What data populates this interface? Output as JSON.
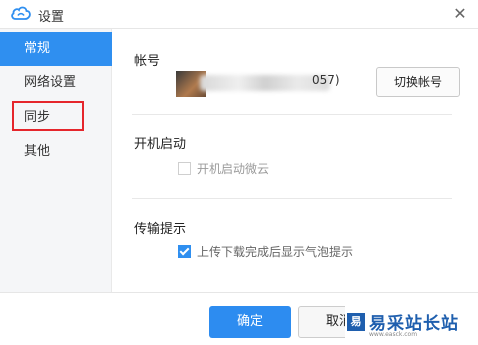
{
  "window": {
    "title": "设置",
    "close_symbol": "✕"
  },
  "sidebar": {
    "items": [
      {
        "label": "常规",
        "active": true
      },
      {
        "label": "网络设置",
        "active": false
      },
      {
        "label": "同步",
        "active": false,
        "highlighted": true
      },
      {
        "label": "其他",
        "active": false
      }
    ],
    "active_color": "#2f8ff0",
    "highlight_color": "#e5262c"
  },
  "account": {
    "section_label": "帐号",
    "visible_suffix": "057)",
    "switch_button": "切换帐号"
  },
  "startup": {
    "section_label": "开机启动",
    "checkbox_label": "开机启动微云",
    "checked": false,
    "disabled": true
  },
  "transfer": {
    "section_label": "传输提示",
    "checkbox_label": "上传下载完成后显示气泡提示",
    "checked": true
  },
  "footer": {
    "ok_label": "确定",
    "cancel_label": "取消"
  },
  "watermark": {
    "text": "易采站长站",
    "url": "www.easck.com",
    "logo_icon": "easck-logo-icon"
  },
  "icons": {
    "title": "cloud-icon",
    "close": "close-icon",
    "check": "check-icon"
  }
}
